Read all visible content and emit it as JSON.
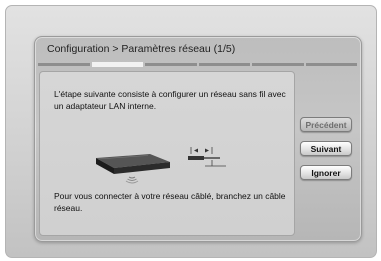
{
  "dialog": {
    "title": "Configuration > Paramètres réseau (1/5)",
    "steps": {
      "total": 5,
      "current": 1
    }
  },
  "content": {
    "instruction_main": "L'étape suivante consiste à configurer un réseau sans fil avec un adaptateur LAN interne.",
    "instruction_cable": "Pour vous connecter à votre réseau câblé, branchez un câble réseau."
  },
  "buttons": {
    "previous": "Précédent",
    "next": "Suivant",
    "skip": "Ignorer"
  },
  "icons": {
    "device": "blu-ray-player-icon",
    "cable": "lan-cable-icon"
  }
}
